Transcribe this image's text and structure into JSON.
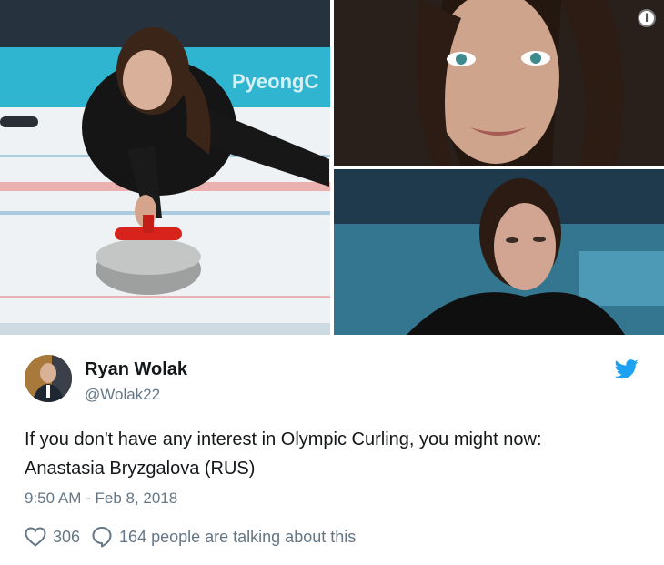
{
  "media": {
    "photos": [
      "curling-player-photo",
      "portrait-smiling-photo",
      "portrait-serious-photo"
    ],
    "arena_banner_text": "PyeongC",
    "info_icon": "info-icon"
  },
  "tweet": {
    "author_name": "Ryan Wolak",
    "author_handle": "@Wolak22",
    "text_line1": "If you don't have any interest in Olympic Curling, you might now:",
    "text_line2": "Anastasia Bryzgalova (RUS)",
    "timestamp": "9:50 AM - Feb 8, 2018",
    "like_count": "306",
    "talking_text": "164 people are talking about this",
    "brand_color": "#1da1f2"
  }
}
